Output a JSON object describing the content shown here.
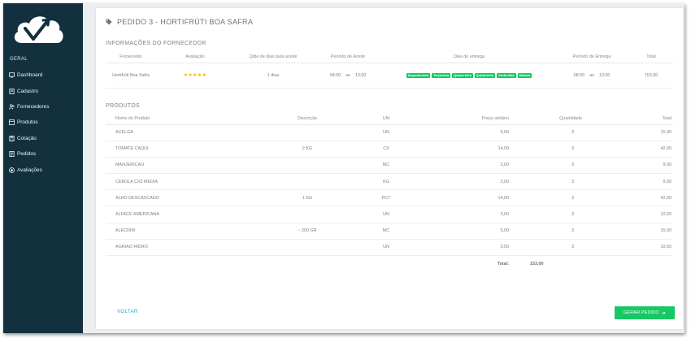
{
  "sidebar": {
    "section": "GERAL",
    "items": [
      {
        "label": "Dashboard",
        "icon": "monitor-icon"
      },
      {
        "label": "Cadastro",
        "icon": "document-icon"
      },
      {
        "label": "Fornecedores",
        "icon": "users-icon"
      },
      {
        "label": "Produtos",
        "icon": "box-icon"
      },
      {
        "label": "Cotação",
        "icon": "calculator-icon"
      },
      {
        "label": "Pedidos",
        "icon": "receipt-icon"
      },
      {
        "label": "Avaliações",
        "icon": "star-circle-icon"
      }
    ]
  },
  "order": {
    "title": "PEDIDO 3 - HORTIFRÚTI BOA SAFRA"
  },
  "supplier": {
    "section_title": "INFORMAÇÕES DO FORNECEDOR",
    "headers": [
      "Fornecedor",
      "Avaliação",
      "Qtde de dias para aceite",
      "Periodo de Aceite",
      "Dias de entrega",
      "Periodo de Entrega",
      "Total"
    ],
    "name": "Hortifrúti Boa Safra",
    "rating_stars": "★★★★★",
    "accept_days": "1 dias",
    "accept_from": "08:00",
    "accept_sep": "as",
    "accept_to": "13:00",
    "delivery_days": [
      "Segunda-feira",
      "Terça-feira",
      "Quarta-feira",
      "Quinta-feira",
      "Sexta-feira",
      "Sábado"
    ],
    "delivery_from": "08:00",
    "delivery_sep": "as",
    "delivery_to": "13:00",
    "total": "153,00"
  },
  "products": {
    "section_title": "PRODUTOS",
    "headers": [
      "Nome do Produto",
      "Descrição",
      "UM",
      "Preço unitário",
      "Quantidade",
      "Total"
    ],
    "rows": [
      {
        "name": "ACELGA",
        "desc": "",
        "um": "UN",
        "price": "5,00",
        "qty": "3",
        "total": "15,00"
      },
      {
        "name": "TOMATE CAQUI",
        "desc": "2 KG",
        "um": "CX",
        "price": "14,00",
        "qty": "3",
        "total": "42,00"
      },
      {
        "name": "MANJERICAO",
        "desc": "",
        "um": "MC",
        "price": "3,00",
        "qty": "3",
        "total": "9,00"
      },
      {
        "name": "CEBOLA CX3 MEDIA",
        "desc": "",
        "um": "KG",
        "price": "3,00",
        "qty": "3",
        "total": "9,00"
      },
      {
        "name": "ALHO DESCASCADO",
        "desc": "1 KG",
        "um": "PCT",
        "price": "14,00",
        "qty": "3",
        "total": "42,00"
      },
      {
        "name": "ALFACE AMERICANA",
        "desc": "",
        "um": "UN",
        "price": "3,50",
        "qty": "3",
        "total": "10,50"
      },
      {
        "name": "ALECRIM",
        "desc": "~ 200 GR",
        "um": "MC",
        "price": "5,00",
        "qty": "3",
        "total": "15,00"
      },
      {
        "name": "AGRIAO HIDRO",
        "desc": "",
        "um": "UN",
        "price": "3,50",
        "qty": "3",
        "total": "10,50"
      }
    ],
    "total_label": "Total:",
    "total_value": "153,00"
  },
  "actions": {
    "back_label": "VOLTAR",
    "generate_label": "GERAR PEDIDO"
  },
  "colors": {
    "sidebar_bg": "#12303d",
    "accent_green": "#16c964",
    "link_blue": "#2aa4c5"
  }
}
